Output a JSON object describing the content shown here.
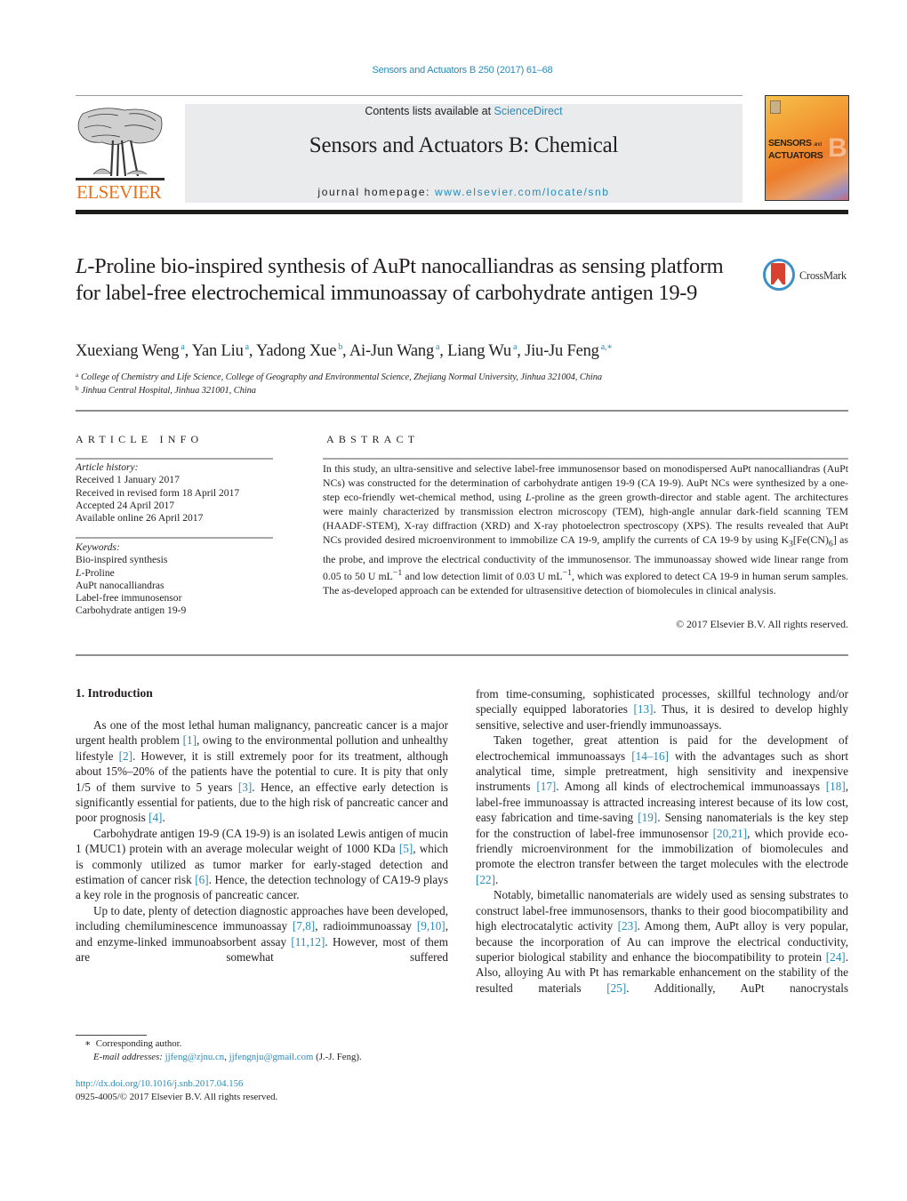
{
  "header": {
    "citation": "Sensors and Actuators B 250 (2017) 61–68",
    "contents_prefix": "Contents lists available at ",
    "contents_link": "ScienceDirect",
    "journal_title": "Sensors and Actuators B: Chemical",
    "homepage_prefix": "journal homepage: ",
    "homepage_link": "www.elsevier.com/locate/snb",
    "publisher_logo": "ELSEVIER",
    "cover": {
      "line1": "SENSORS",
      "and": "and",
      "line2": "ACTUATORS",
      "letter": "B"
    }
  },
  "colors": {
    "link": "#2a8ab8",
    "elsevier_orange": "#e9711c",
    "crossmark_red": "#d8412f",
    "crossmark_blue": "#3d8fc7"
  },
  "article": {
    "title_italic": "L",
    "title_rest": "-Proline bio-inspired synthesis of AuPt nanocalliandras as sensing platform for label-free electrochemical immunoassay of carbohydrate antigen 19-9",
    "crossmark_label": "CrossMark",
    "authors": [
      {
        "name": "Xuexiang Weng",
        "aff": "a"
      },
      {
        "name": "Yan Liu",
        "aff": "a"
      },
      {
        "name": "Yadong Xue",
        "aff": "b"
      },
      {
        "name": "Ai-Jun Wang",
        "aff": "a"
      },
      {
        "name": "Liang Wu",
        "aff": "a"
      },
      {
        "name": "Jiu-Ju Feng",
        "aff": "a,∗"
      }
    ],
    "affiliations": [
      {
        "key": "a",
        "text": "College of Chemistry and Life Science, College of Geography and Environmental Science, Zhejiang Normal University, Jinhua 321004, China"
      },
      {
        "key": "b",
        "text": "Jinhua Central Hospital, Jinhua 321001, China"
      }
    ]
  },
  "article_info": {
    "heading": "ARTICLE INFO",
    "history_label": "Article history:",
    "history": [
      "Received 1 January 2017",
      "Received in revised form 18 April 2017",
      "Accepted 24 April 2017",
      "Available online 26 April 2017"
    ],
    "keywords_label": "Keywords:",
    "keywords": [
      "Bio-inspired synthesis",
      "L-Proline",
      "AuPt nanocalliandras",
      "Label-free immunosensor",
      "Carbohydrate antigen 19-9"
    ]
  },
  "abstract": {
    "heading": "ABSTRACT",
    "parts": [
      "In this study, an ultra-sensitive and selective label-free immunosensor based on monodispersed AuPt nanocalliandras (AuPt NCs) was constructed for the determination of carbohydrate antigen 19-9 (CA 19-9). AuPt NCs were synthesized by a one-step eco-friendly wet-chemical method, using ",
      "L",
      "-proline as the green growth-director and stable agent. The architectures were mainly characterized by transmission electron microscopy (TEM), high-angle annular dark-field scanning TEM (HAADF-STEM), X-ray diffraction (XRD) and X-ray photoelectron spectroscopy (XPS). The results revealed that AuPt NCs provided desired microenvironment to immobilize CA 19-9, amplify the currents of CA 19-9 by using K",
      "3",
      "[Fe(CN)",
      "6",
      "] as the probe, and improve the electrical conductivity of the immunosensor. The immunoassay showed wide linear range from 0.05 to 50 U mL",
      "−1",
      " and low detection limit of 0.03 U mL",
      "−1",
      ", which was explored to detect CA 19-9 in human serum samples. The as-developed approach can be extended for ultrasensitive detection of biomolecules in clinical analysis."
    ],
    "copyright": "© 2017 Elsevier B.V. All rights reserved."
  },
  "intro": {
    "heading": "1.  Introduction",
    "p1": [
      "As one of the most lethal human malignancy, pancreatic cancer is a major urgent health problem ",
      "[1]",
      ", owing to the environmental pollution and unhealthy lifestyle ",
      "[2]",
      ". However, it is still extremely poor for its treatment, although about 15%–20% of the patients have the potential to cure. It is pity that only 1/5 of them survive to 5 years ",
      "[3]",
      ". Hence, an effective early detection is significantly essential for patients, due to the high risk of pancreatic cancer and poor prognosis ",
      "[4]",
      "."
    ],
    "p2": [
      "Carbohydrate antigen 19-9 (CA 19-9) is an isolated Lewis antigen of mucin 1 (MUC1) protein with an average molecular weight of 1000 KDa ",
      "[5]",
      ", which is commonly utilized as tumor marker for early-staged detection and estimation of cancer risk ",
      "[6]",
      ". Hence, the detection technology of CA19-9 plays a key role in the prognosis of pancreatic cancer."
    ],
    "p3": [
      "Up to date, plenty of detection diagnostic approaches have been developed, including chemiluminescence immunoassay ",
      "[7,8]",
      ", radioimmunoassay ",
      "[9,10]",
      ", and enzyme-linked immunoabsorbent assay ",
      "[11,12]",
      ". However, most of them are somewhat suffered"
    ],
    "p4": [
      "from time-consuming, sophisticated processes, skillful technology and/or specially equipped laboratories ",
      "[13]",
      ". Thus, it is desired to develop highly sensitive, selective and user-friendly immunoassays."
    ],
    "p5": [
      "Taken together, great attention is paid for the development of electrochemical immunoassays ",
      "[14–16]",
      " with the advantages such as short analytical time, simple pretreatment, high sensitivity and inexpensive instruments ",
      "[17]",
      ". Among all kinds of electrochemical immunoassays ",
      "[18]",
      ", label-free immunoassay is attracted increasing interest because of its low cost, easy fabrication and time-saving ",
      "[19]",
      ". Sensing nanomaterials is the key step for the construction of label-free immunosensor ",
      "[20,21]",
      ", which provide eco-friendly microenvironment for the immobilization of biomolecules and promote the electron transfer between the target molecules with the electrode ",
      "[22]",
      "."
    ],
    "p6": [
      "Notably, bimetallic nanomaterials are widely used as sensing substrates to construct label-free immunosensors, thanks to their good biocompatibility and high electrocatalytic activity ",
      "[23]",
      ". Among them, AuPt alloy is very popular, because the incorporation of Au can improve the electrical conductivity, superior biological stability and enhance the biocompatibility to protein ",
      "[24]",
      ". Also, alloying Au with Pt has remarkable enhancement on the stability of the resulted materials ",
      "[25]",
      ". Additionally, AuPt nanocrystals"
    ]
  },
  "footnote": {
    "marker": "∗",
    "corresponding": "Corresponding author.",
    "email_label": "E-mail addresses:",
    "email1": "jjfeng@zjnu.cn",
    "sep": ", ",
    "email2": "jjfengnju@gmail.com",
    "email_suffix": " (J.-J. Feng)."
  },
  "doi": {
    "link": "http://dx.doi.org/10.1016/j.snb.2017.04.156",
    "issn_line": "0925-4005/© 2017 Elsevier B.V. All rights reserved."
  }
}
